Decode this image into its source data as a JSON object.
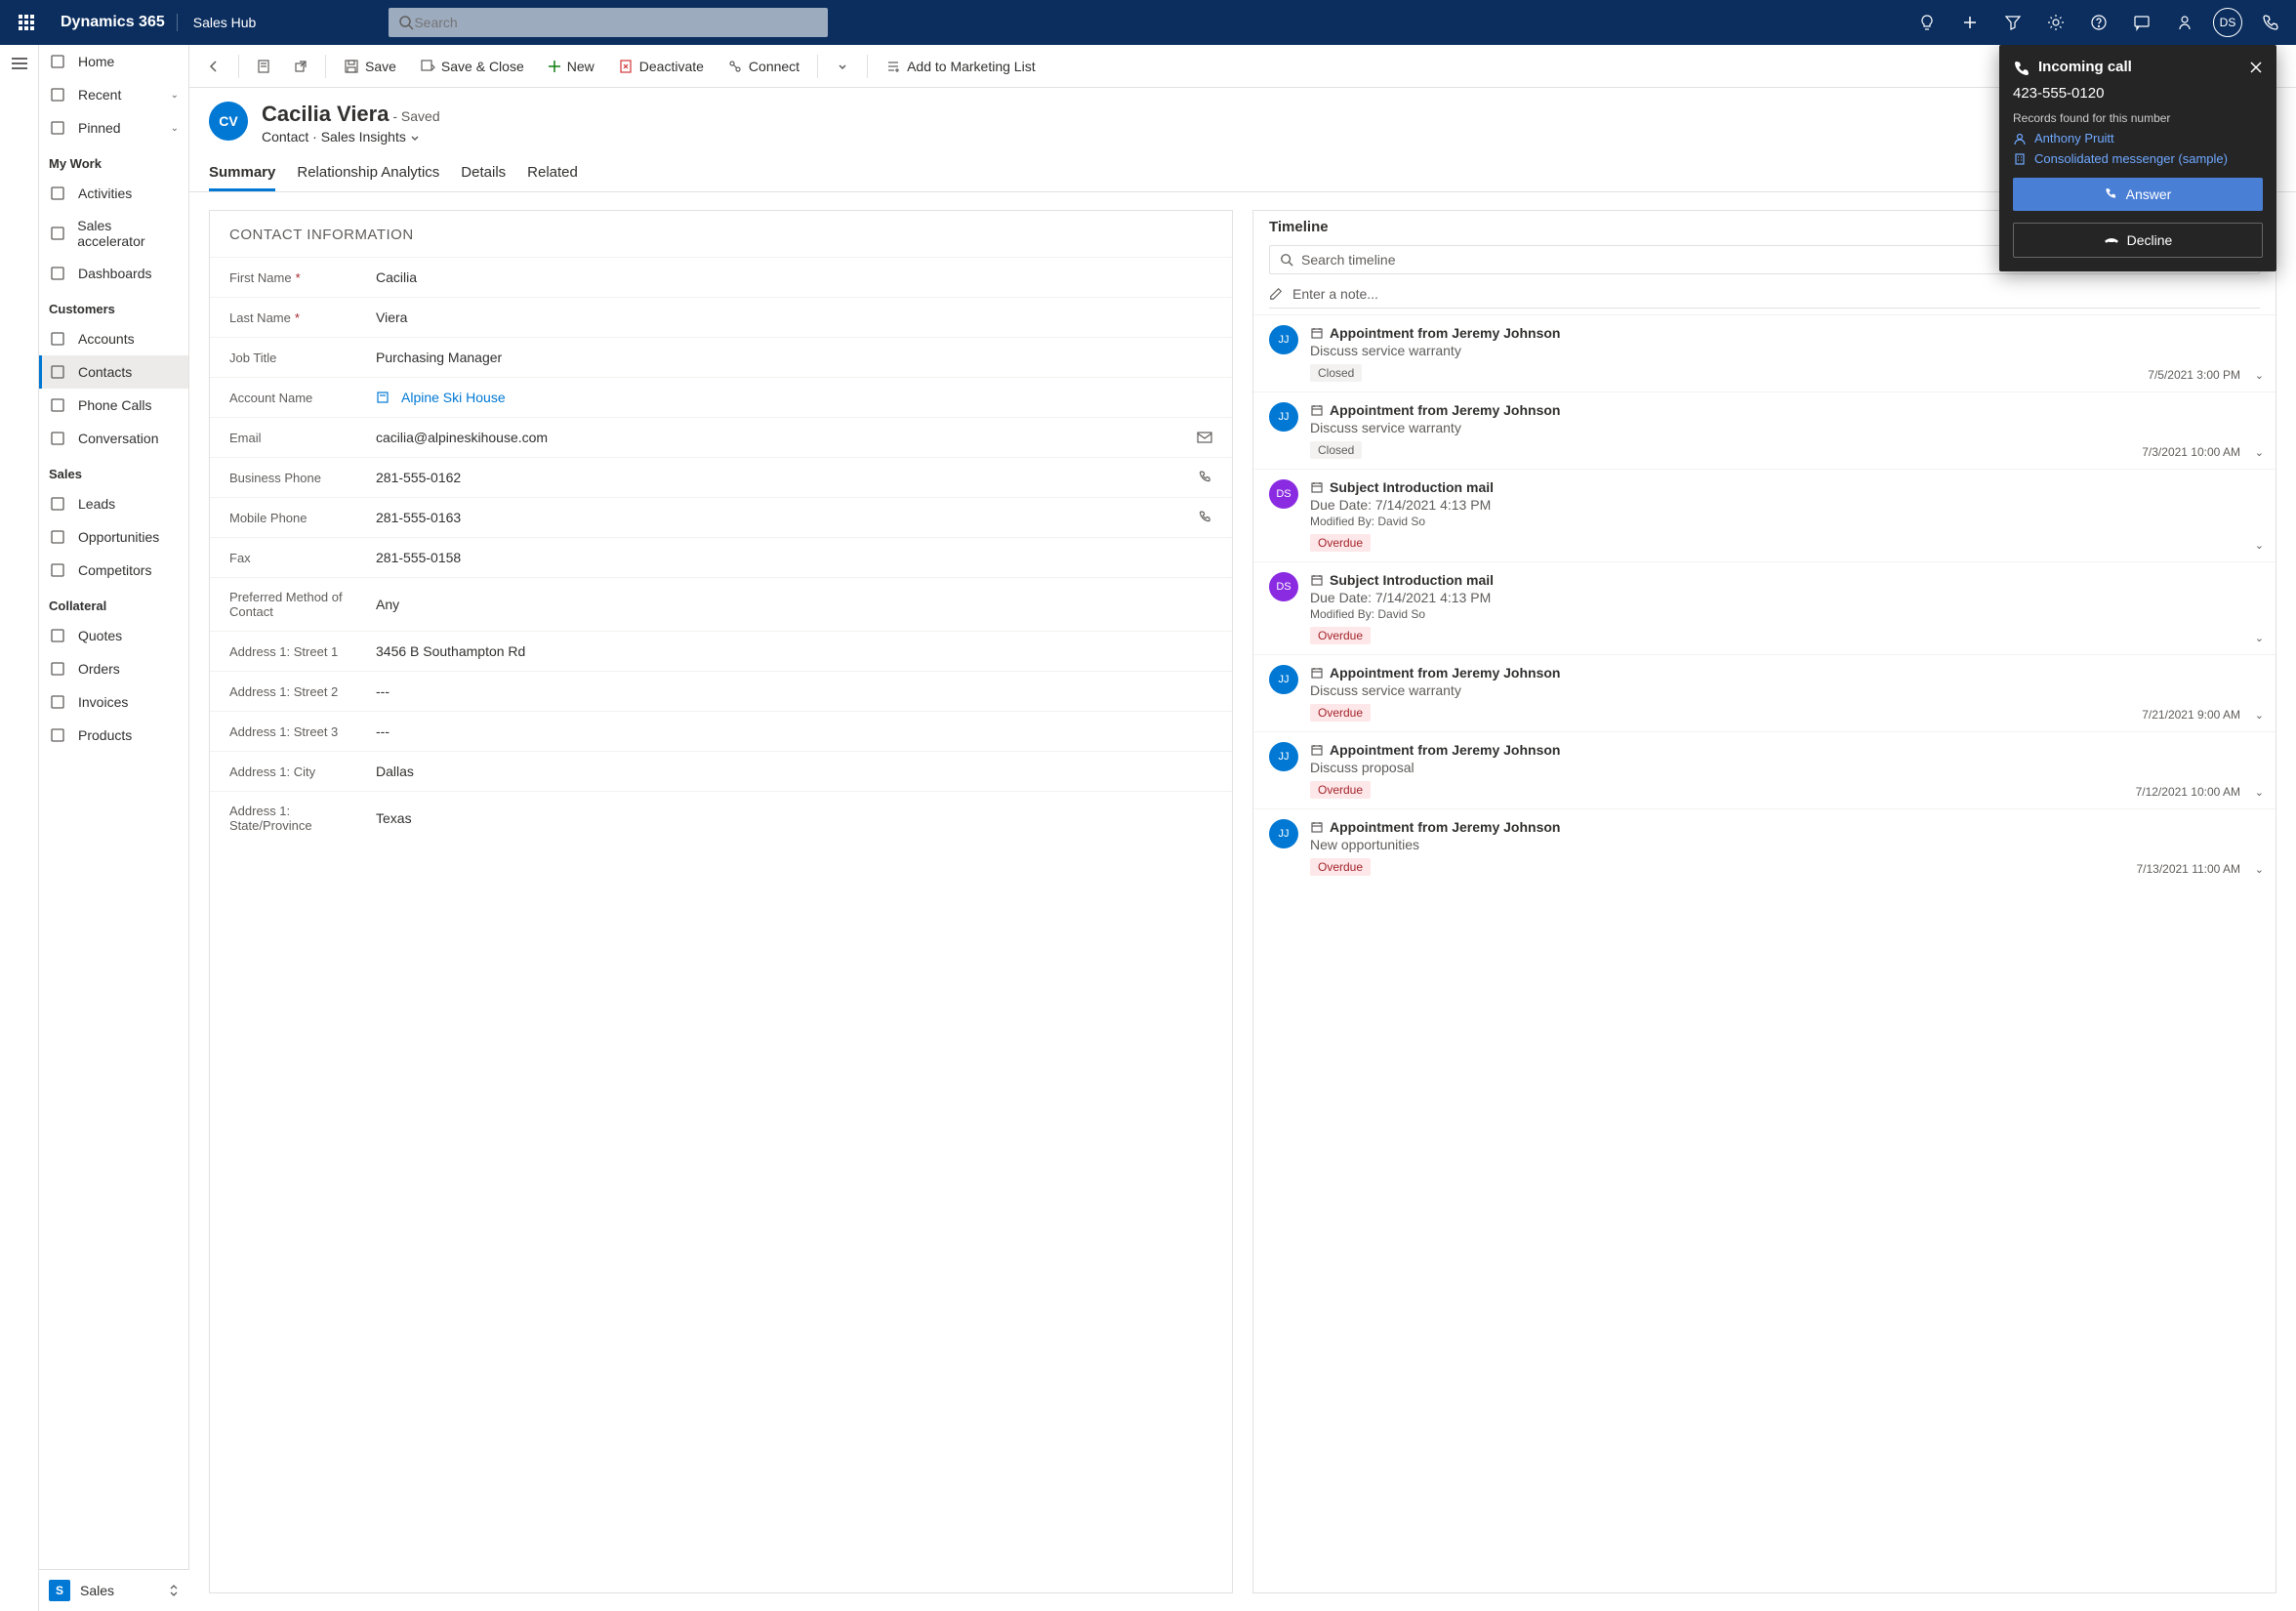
{
  "topbar": {
    "brand": "Dynamics 365",
    "hub": "Sales Hub",
    "search_placeholder": "Search",
    "user_initials": "DS"
  },
  "sidebar": {
    "items_top": [
      {
        "label": "Home",
        "icon": "home"
      },
      {
        "label": "Recent",
        "icon": "clock",
        "chev": true
      },
      {
        "label": "Pinned",
        "icon": "pin",
        "chev": true
      }
    ],
    "sec_mywork": "My Work",
    "mywork": [
      {
        "label": "Activities",
        "icon": "check"
      },
      {
        "label": "Sales accelerator",
        "icon": "rocket"
      },
      {
        "label": "Dashboards",
        "icon": "dash"
      }
    ],
    "sec_customers": "Customers",
    "customers": [
      {
        "label": "Accounts",
        "icon": "building"
      },
      {
        "label": "Contacts",
        "icon": "person",
        "active": true
      },
      {
        "label": "Phone Calls",
        "icon": "phone"
      },
      {
        "label": "Conversation",
        "icon": "gear"
      }
    ],
    "sec_sales": "Sales",
    "sales": [
      {
        "label": "Leads",
        "icon": "leads"
      },
      {
        "label": "Opportunities",
        "icon": "opp"
      },
      {
        "label": "Competitors",
        "icon": "comp"
      }
    ],
    "sec_collateral": "Collateral",
    "collateral": [
      {
        "label": "Quotes",
        "icon": "quote"
      },
      {
        "label": "Orders",
        "icon": "order"
      },
      {
        "label": "Invoices",
        "icon": "invoice"
      },
      {
        "label": "Products",
        "icon": "product"
      }
    ],
    "area_badge": "S",
    "area_label": "Sales"
  },
  "cmdbar": {
    "save": "Save",
    "save_close": "Save & Close",
    "new": "New",
    "deactivate": "Deactivate",
    "connect": "Connect",
    "marketing": "Add to Marketing List"
  },
  "record": {
    "initials": "CV",
    "name": "Cacilia Viera",
    "status": " - Saved",
    "entity": "Contact",
    "form": "Sales Insights"
  },
  "tabs": [
    "Summary",
    "Relationship Analytics",
    "Details",
    "Related"
  ],
  "contact": {
    "section_title": "CONTACT INFORMATION",
    "fields": [
      {
        "label": "First Name",
        "value": "Cacilia",
        "req": true
      },
      {
        "label": "Last Name",
        "value": "Viera",
        "req": true
      },
      {
        "label": "Job Title",
        "value": "Purchasing Manager"
      },
      {
        "label": "Account Name",
        "value": "Alpine Ski House",
        "link": true,
        "linkicon": true
      },
      {
        "label": "Email",
        "value": "cacilia@alpineskihouse.com",
        "action": "mail"
      },
      {
        "label": "Business Phone",
        "value": "281-555-0162",
        "action": "phone"
      },
      {
        "label": "Mobile Phone",
        "value": "281-555-0163",
        "action": "phone"
      },
      {
        "label": "Fax",
        "value": "281-555-0158"
      },
      {
        "label": "Preferred Method of Contact",
        "value": "Any"
      },
      {
        "label": "Address 1: Street 1",
        "value": "3456 B Southampton Rd"
      },
      {
        "label": "Address 1: Street 2",
        "value": "---"
      },
      {
        "label": "Address 1: Street 3",
        "value": "---"
      },
      {
        "label": "Address 1: City",
        "value": "Dallas"
      },
      {
        "label": "Address 1: State/Province",
        "value": "Texas"
      }
    ]
  },
  "timeline": {
    "title": "Timeline",
    "search_placeholder": "Search timeline",
    "note_placeholder": "Enter a note...",
    "items": [
      {
        "avatar": "JJ",
        "color": "#0078d4",
        "title": "Appointment from Jeremy Johnson",
        "desc": "Discuss service warranty",
        "badge": "Closed",
        "date": "7/5/2021 3:00 PM"
      },
      {
        "avatar": "JJ",
        "color": "#0078d4",
        "title": "Appointment from Jeremy Johnson",
        "desc": "Discuss service warranty",
        "badge": "Closed",
        "date": "7/3/2021 10:00 AM"
      },
      {
        "avatar": "DS",
        "color": "#8a2be2",
        "title": "Subject Introduction mail",
        "desc": "Due Date: 7/14/2021 4:13 PM",
        "meta": "Modified By: David So",
        "badge": "Overdue",
        "date": ""
      },
      {
        "avatar": "DS",
        "color": "#8a2be2",
        "title": "Subject Introduction mail",
        "desc": "Due Date: 7/14/2021 4:13 PM",
        "meta": "Modified By: David So",
        "badge": "Overdue",
        "date": ""
      },
      {
        "avatar": "JJ",
        "color": "#0078d4",
        "title": "Appointment from Jeremy Johnson",
        "desc": "Discuss service warranty",
        "badge": "Overdue",
        "date": "7/21/2021 9:00 AM"
      },
      {
        "avatar": "JJ",
        "color": "#0078d4",
        "title": "Appointment from Jeremy Johnson",
        "desc": "Discuss proposal",
        "badge": "Overdue",
        "date": "7/12/2021 10:00 AM"
      },
      {
        "avatar": "JJ",
        "color": "#0078d4",
        "title": "Appointment from Jeremy Johnson",
        "desc": "New opportunities",
        "badge": "Overdue",
        "date": "7/13/2021 11:00 AM"
      }
    ]
  },
  "call": {
    "title": "Incoming call",
    "number": "423-555-0120",
    "records_found": "Records found for this number",
    "person": "Anthony Pruitt",
    "account": "Consolidated messenger (sample)",
    "answer": "Answer",
    "decline": "Decline"
  }
}
